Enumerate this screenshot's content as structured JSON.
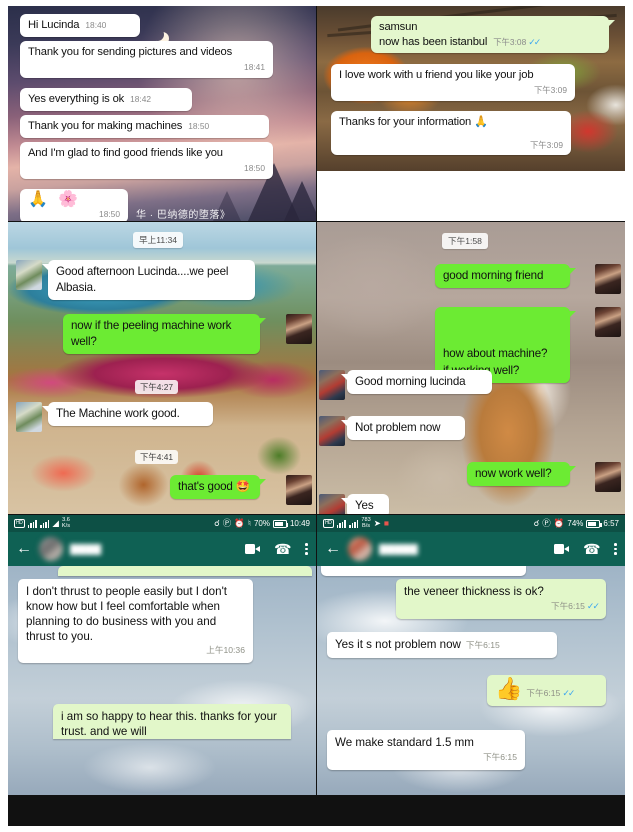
{
  "document": {
    "type": "whatsapp-chat-screenshot-collage",
    "panels": 6
  },
  "panel1": {
    "name": "twilight-wallpaper-chat",
    "wallpaper_caption": "华 · 巴纳德的堕落》",
    "messages": [
      {
        "dir": "in",
        "text": "Hi Lucinda",
        "time": "18:40"
      },
      {
        "dir": "in",
        "text": "Thank you for sending pictures and videos",
        "time": "18:41"
      },
      {
        "dir": "in",
        "text": "Yes everything is ok",
        "time": "18:42"
      },
      {
        "dir": "in",
        "text": "Thank you for making machines",
        "time": "18:50"
      },
      {
        "dir": "in",
        "text": "And I'm glad to find good friends like you",
        "time": "18:50"
      },
      {
        "dir": "in",
        "text": "🙏 🌸",
        "time": "18:50"
      }
    ]
  },
  "panel2": {
    "name": "food-wallpaper-chat",
    "messages": [
      {
        "dir": "out",
        "text": "samsun\nnow has been istanbul",
        "time": "下午3:08",
        "ticks": "✓✓"
      },
      {
        "dir": "in",
        "text": "I love work with u friend you like your job",
        "time": "下午3:09"
      },
      {
        "dir": "in",
        "text": "Thanks for your information 🙏",
        "time": "下午3:09"
      }
    ]
  },
  "panel3": {
    "name": "resort-wallpaper-chat",
    "day_pill": "早上11:34",
    "float_times": [
      "下午4:27",
      "下午4:41"
    ],
    "messages": [
      {
        "dir": "in",
        "text": "Good afternoon Lucinda....we peel Albasia."
      },
      {
        "dir": "out",
        "text": "now if the peeling machine work well?"
      },
      {
        "dir": "in",
        "text": "The Machine work good."
      },
      {
        "dir": "out",
        "text": "that's good 🤩"
      }
    ]
  },
  "panel4": {
    "name": "dog-wallpaper-chat",
    "day_pill": "下午1:58",
    "messages": [
      {
        "dir": "out",
        "text": "good morning friend"
      },
      {
        "dir": "out",
        "text": "how about machine?\nif working well?"
      },
      {
        "dir": "in",
        "text": "Good morning lucinda"
      },
      {
        "dir": "in",
        "text": "Not problem now"
      },
      {
        "dir": "out",
        "text": "now work well?"
      },
      {
        "dir": "in",
        "text": "Yes"
      }
    ]
  },
  "panel5": {
    "name": "whatsapp-ui-trust-chat",
    "statusbar": {
      "hd_label": "HD",
      "data_rate": "3.6",
      "data_rate_unit": "K/s",
      "battery_percent": "70%",
      "clock": "10:49"
    },
    "appbar": {
      "back_icon": "arrow-left",
      "contact_name": "",
      "video_icon": "video-camera",
      "phone_icon": "phone",
      "menu_icon": "overflow-menu"
    },
    "messages": [
      {
        "dir": "in",
        "text": "I don't thrust to people easily but I  don't know how but I feel comfortable when planning to do business with you and thrust to you.",
        "time": "上午10:36"
      },
      {
        "dir": "out",
        "text": "i am so happy to hear this. thanks for your trust. and we will"
      }
    ]
  },
  "panel6": {
    "name": "whatsapp-ui-veneer-chat",
    "statusbar": {
      "hd_label": "HD",
      "data_rate": "783",
      "data_rate_unit": "B/s",
      "battery_percent": "74%",
      "clock": "6:57"
    },
    "appbar": {
      "back_icon": "arrow-left",
      "contact_name": "",
      "video_icon": "video-camera",
      "phone_icon": "phone",
      "menu_icon": "overflow-menu"
    },
    "messages": [
      {
        "dir": "out",
        "text": "the veneer thickness is ok?",
        "time": "下午6:15",
        "ticks": "✓✓"
      },
      {
        "dir": "in",
        "text": "Yes it s not problem now",
        "time": "下午6:15"
      },
      {
        "dir": "out",
        "text": "👍",
        "time": "下午6:15",
        "ticks": "✓✓"
      },
      {
        "dir": "in",
        "text": "We make standard 1.5 mm",
        "time": "下午6:15"
      }
    ]
  },
  "colors": {
    "bubble_out_bright": "#6ceb33",
    "bubble_out_pale": "#e2f7c9",
    "bubble_in": "#ffffff",
    "appbar": "#0f6154",
    "statusbar": "#0d5045",
    "tick_blue": "#3ba6f0"
  }
}
